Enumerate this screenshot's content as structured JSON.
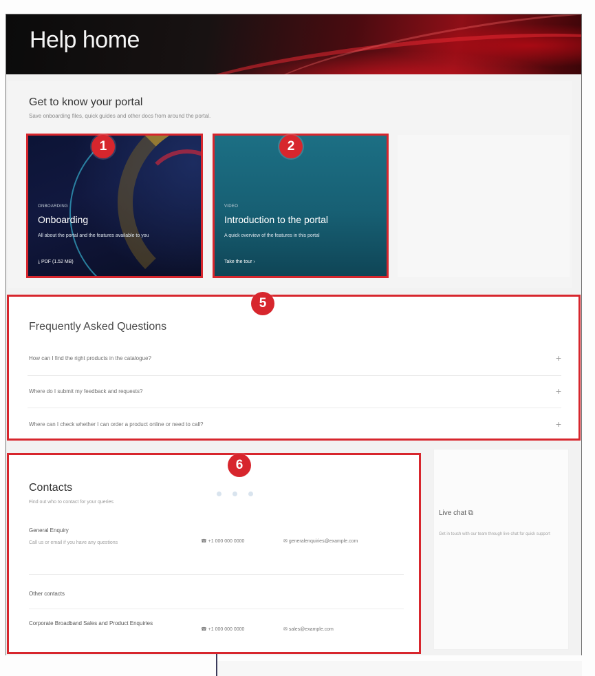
{
  "hero": {
    "title": "Help home"
  },
  "know_portal": {
    "title": "Get to know your portal",
    "subtitle": "Save onboarding files, quick guides and other docs from around the portal.",
    "cards": [
      {
        "badge": "1",
        "eyebrow": "ONBOARDING",
        "title": "Onboarding",
        "description": "All about the portal and the features available to you",
        "link": "PDF (1.52 MB)"
      },
      {
        "badge": "2",
        "eyebrow": "VIDEO",
        "title": "Introduction to the portal",
        "description": "A quick overview of the features in this portal",
        "link": "Take the tour"
      }
    ]
  },
  "faq": {
    "badge": "5",
    "title": "Frequently Asked Questions",
    "questions": [
      "How can I find the right products in the catalogue?",
      "Where do I submit my feedback and requests?",
      "Where can I check whether I can order a product online or need to call?"
    ],
    "expand_symbol": "+"
  },
  "contacts": {
    "badge": "6",
    "title": "Contacts",
    "subtitle": "Find out who to contact for your queries",
    "general": {
      "label": "General Enquiry",
      "note": "Call us or email if you have any questions",
      "phone": "+1 000 000 0000",
      "email": "generalenquiries@example.com"
    },
    "other_label": "Other contacts",
    "sales": {
      "label": "Corporate Broadband Sales and Product Enquiries",
      "phone": "+1 000 000 0000",
      "email": "sales@example.com"
    }
  },
  "livechat": {
    "title": "Live chat",
    "subtitle": "Get in touch with our team through live chat for quick support"
  }
}
